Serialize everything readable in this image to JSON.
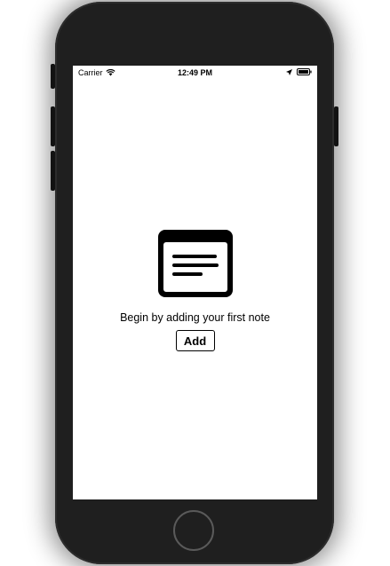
{
  "status_bar": {
    "carrier": "Carrier",
    "time": "12:49 PM",
    "wifi_icon": "wifi-icon",
    "location_icon": "location-arrow-icon",
    "battery_icon": "battery-icon"
  },
  "empty_state": {
    "icon": "note-list-icon",
    "message": "Begin by adding your first note",
    "add_label": "Add"
  },
  "colors": {
    "device_body": "#1f1f1f",
    "screen_bg": "#ffffff",
    "text": "#000000"
  }
}
